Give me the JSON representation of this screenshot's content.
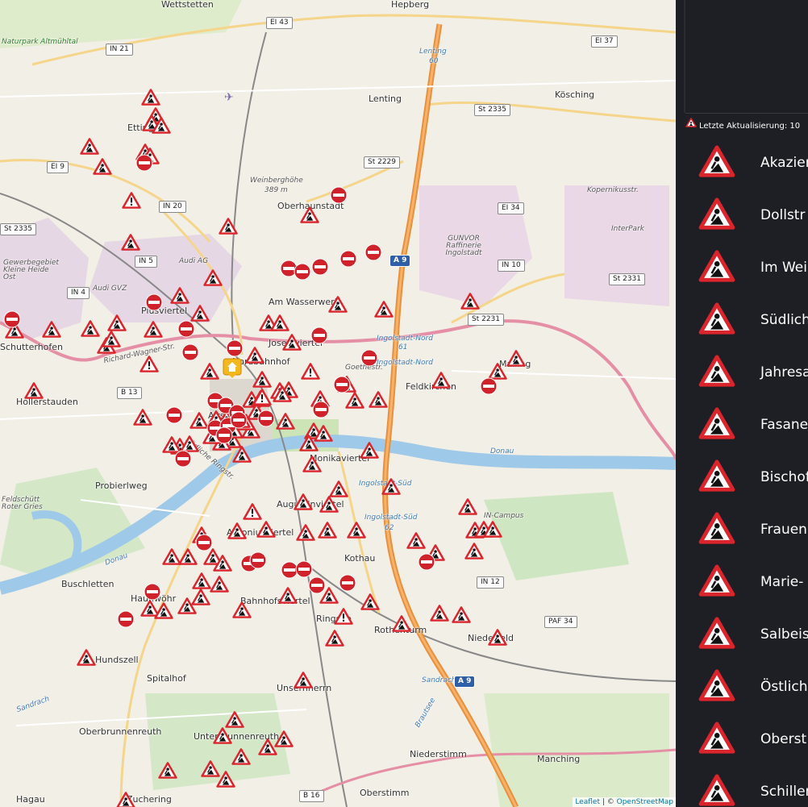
{
  "map": {
    "places": [
      "Wettstetten",
      "Hepberg",
      "Naturpark Altmühltal",
      "Lenting",
      "Kösching",
      "Etting",
      "Weinberghöhe",
      "389 m",
      "Oberhaunstadt",
      "Gewerbegebiet Kleine Heide Ost",
      "Audi AG",
      "Audi GVZ",
      "Piusviertel",
      "Mailing",
      "Am Wasserwerk",
      "GUNVOR Raffinerie Ingolstadt",
      "InterPark",
      "Josefsviertel",
      "Nordbahnhof",
      "Hollerstauden",
      "Feldkirchen",
      "Altstadt",
      "Monikaviertel",
      "Probierlweg",
      "Feldschütt Roter Gries",
      "Augustinviertel",
      "IN-Campus",
      "Antoniusviertel",
      "Kothau",
      "Buschletten",
      "Haunwöhr",
      "Bahnhofsviertel",
      "Ringsee",
      "Rothenturm",
      "Niederfeld",
      "Hundszell",
      "Spitalhof",
      "Unsernherrn",
      "Oberbrunnenreuth",
      "Unterbrunnenreuth",
      "Niederstimm",
      "Manching",
      "Zuchering",
      "Oberstimm",
      "Hagau",
      "Schutterhofen"
    ],
    "streets": [
      "Richard-Wagner-Str.",
      "Goethestr.",
      "Kopernikusstr.",
      "Donau",
      "Donau",
      "Sandrach",
      "Sandrach",
      "Brautsee",
      "Ingolstadt-Nord",
      "Ingolstadt-Nord",
      "Ingolstadt-Süd",
      "Ingolstadt-Süd",
      "Lenting",
      "61",
      "62",
      "60",
      "Südliche Ringstr."
    ],
    "shields": [
      "IN 21",
      "EI 43",
      "EI 37",
      "EI 9",
      "St 2335",
      "St 2335",
      "St 2229",
      "IN 20",
      "EI 34",
      "IN 5",
      "A 9",
      "IN 10",
      "St 2331",
      "IN 4",
      "St 2231",
      "B 13",
      "IN 12",
      "PAF 34",
      "A 9",
      "B 16"
    ],
    "attribution": {
      "leaflet": "Leaflet",
      "sep": " | © ",
      "osm": "OpenStreetMap"
    }
  },
  "panel": {
    "update_label": "Letzte Aktualisierung: 10",
    "items": [
      "Akazien",
      "Dollstr",
      "Im Wei",
      "Südlich",
      "Jahresa",
      "Fasane",
      "Bischof",
      "Frauen",
      "Marie-",
      "Salbeis",
      "Östlich",
      "Oberst",
      "Schiller"
    ]
  },
  "colors": {
    "sign_red": "#d9252b",
    "panel_bg": "#1e1f24",
    "motorway": "#e8903c"
  }
}
